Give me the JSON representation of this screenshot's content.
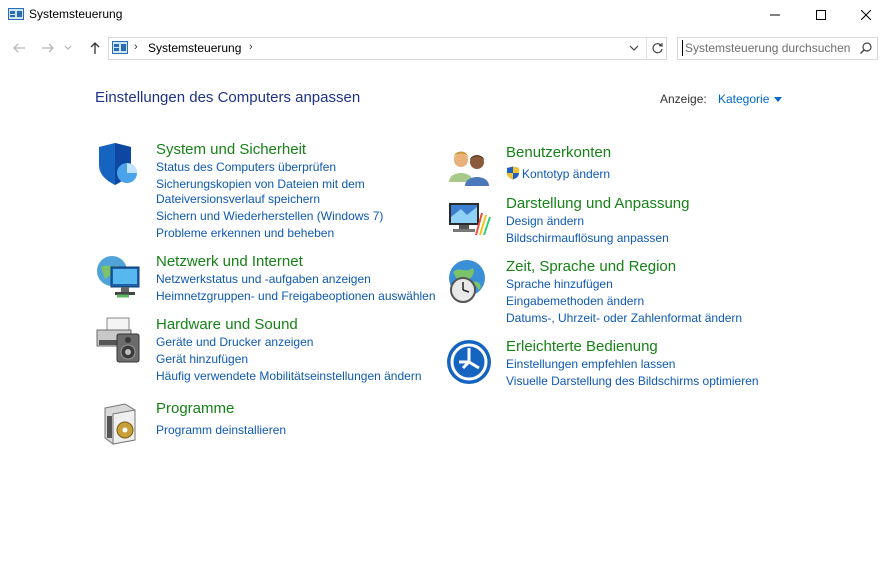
{
  "window": {
    "title": "Systemsteuerung"
  },
  "address": {
    "crumb": "Systemsteuerung"
  },
  "search": {
    "placeholder": "Systemsteuerung durchsuchen"
  },
  "main": {
    "heading": "Einstellungen des Computers anpassen",
    "view_by_label": "Anzeige:",
    "view_by_value": "Kategorie"
  },
  "categories": {
    "system": {
      "title": "System und Sicherheit",
      "links": [
        "Status des Computers überprüfen",
        "Sicherungskopien von Dateien mit dem",
        "Dateiversionsverlauf speichern",
        "Sichern und Wiederherstellen (Windows 7)",
        "Probleme erkennen und beheben"
      ]
    },
    "network": {
      "title": "Netzwerk und Internet",
      "links": [
        "Netzwerkstatus und -aufgaben anzeigen",
        "Heimnetzgruppen- und Freigabeoptionen auswählen"
      ]
    },
    "hardware": {
      "title": "Hardware und Sound",
      "links": [
        "Geräte und Drucker anzeigen",
        "Gerät hinzufügen",
        "Häufig verwendete Mobilitätseinstellungen ändern"
      ]
    },
    "programs": {
      "title": "Programme",
      "links": [
        "Programm deinstallieren"
      ]
    },
    "users": {
      "title": "Benutzerkonten",
      "links": [
        "Kontotyp ändern"
      ]
    },
    "appearance": {
      "title": "Darstellung und Anpassung",
      "links": [
        "Design ändern",
        "Bildschirmauflösung anpassen"
      ]
    },
    "clock": {
      "title": "Zeit, Sprache und Region",
      "links": [
        "Sprache hinzufügen",
        "Eingabemethoden ändern",
        "Datums-, Uhrzeit- oder Zahlenformat ändern"
      ]
    },
    "ease": {
      "title": "Erleichterte Bedienung",
      "links": [
        "Einstellungen empfehlen lassen",
        "Visuelle Darstellung des Bildschirms optimieren"
      ]
    }
  },
  "colors": {
    "heading": "#1e3287",
    "category_title": "#168217",
    "link": "#0e59b4"
  }
}
